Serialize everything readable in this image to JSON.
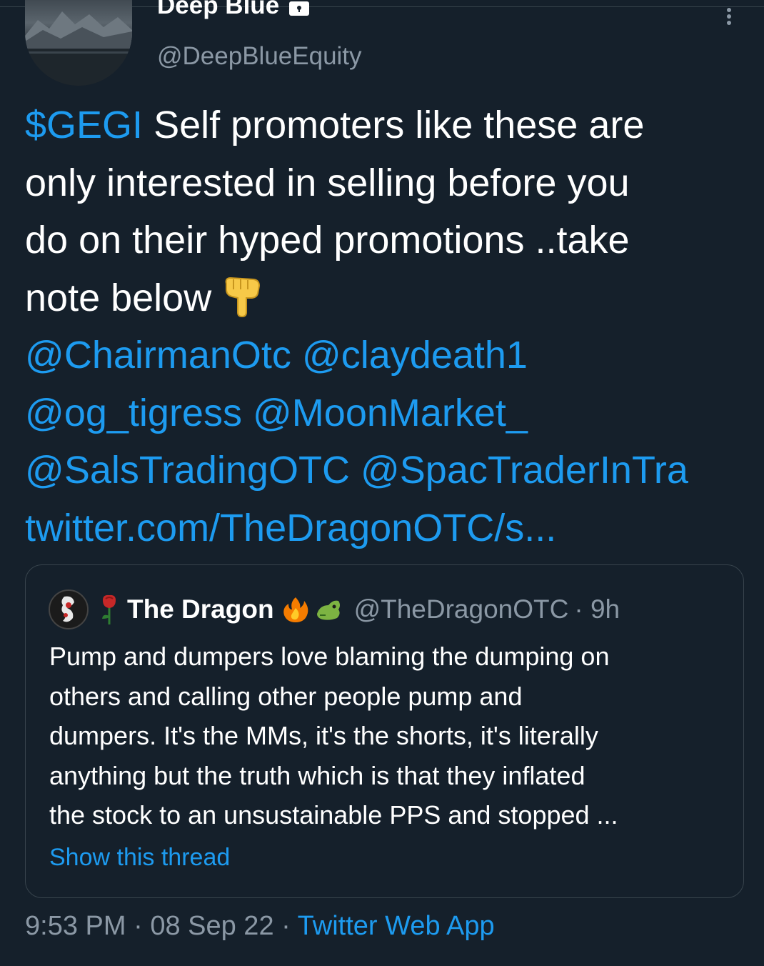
{
  "author": {
    "display_name": "Deep Blue",
    "handle": "@DeepBlueEquity",
    "verified_lock": "lock-icon"
  },
  "tweet": {
    "lines": [
      {
        "cashtag": "$GEGI",
        "text": " Self promoters like these are"
      },
      {
        "text": "only interested in selling before you"
      },
      {
        "text": "do on their hyped promotions ..take"
      },
      {
        "text": "note below",
        "emoji": "backhand-index-pointing-down"
      }
    ],
    "mentions_lines": [
      [
        "@ChairmanOtc",
        "@claydeath1"
      ],
      [
        "@og_tigress",
        "@MoonMarket_"
      ],
      [
        "@SalsTradingOTC",
        "@SpacTraderInTra"
      ]
    ],
    "link": "twitter.com/TheDragonOTC/s..."
  },
  "quoted": {
    "name": "The Dragon",
    "handle": "@TheDragonOTC",
    "time": "· 9h",
    "text_lines": [
      "Pump and dumpers love blaming the dumping on",
      "others and calling other people pump and",
      "dumpers. It's the MMs, it's the shorts, it's literally",
      "anything but the truth which is that they inflated",
      "the stock to an unsustainable PPS and stopped ..."
    ],
    "show_thread": "Show this thread"
  },
  "meta": {
    "time": "9:53 PM",
    "sep1": " · ",
    "date": "08 Sep 22",
    "sep2": " · ",
    "source": "Twitter Web App"
  },
  "colors": {
    "background": "#15202b",
    "link": "#1d9bf0",
    "secondary_text": "#8b98a5",
    "border": "#38444d"
  }
}
